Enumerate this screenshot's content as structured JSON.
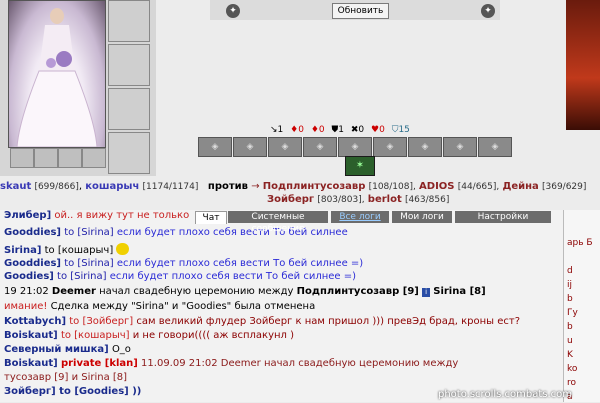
{
  "top": {
    "refresh_label": "Обновить"
  },
  "battle": {
    "stats": [
      "↘1",
      "♦0",
      "♦0",
      "⛊1",
      "✖0",
      "♥0",
      "⛉15"
    ],
    "player1": "skaut",
    "player1_hp": "[699/866]",
    "player2": "кошарыч",
    "player2_hp": "[1174/1174]",
    "versus": "против",
    "enemy1": "Подплинтусозавр",
    "enemy1_hp": "[108/108],",
    "enemy2": "ADIOS",
    "enemy2_hp": "[44/665],",
    "enemy3": "Дейна",
    "enemy3_hp": "[369/629]",
    "enemy4": "Зойберг",
    "enemy4_hp": "[803/803],",
    "enemy5": "berlot",
    "enemy5_hp": "[463/856]"
  },
  "tabs": [
    "Чат",
    "Системные сообщения",
    "Все логи",
    "Мои логи",
    "Настройки"
  ],
  "chat": [
    {
      "nick": "Элибер]",
      "text": "ой.. я вижу тут не только"
    },
    {
      "nick": "Gooddies]",
      "to": "to [Sirina]",
      "text": "если будет плохо себя вести То бей силнее"
    },
    {
      "nick": "Sirina]",
      "to": "to [кошарыч]",
      "text": ""
    },
    {
      "nick": "Gooddies]",
      "to": "to [Sirina]",
      "text": "если будет плохо себя вести То бей силнее =)"
    },
    {
      "nick": "Goodies]",
      "to": "to [Sirina]",
      "text": "если будет плохо себя вести То бей силнее =)"
    },
    {
      "time": "19 21:02",
      "nick": "Deemer",
      "text": "начал свадебную церемонию между",
      "target": "Подплинтусозавр [9]",
      "target2": "Sirina [8]"
    },
    {
      "sys": "имание!",
      "text": "Сделка между \"Sirina\" и \"Goodies\" была отменена"
    },
    {
      "nick": "Kottabych]",
      "to": "to [Зойберг]",
      "text": "сам великий флудер Зойберг к нам пришол ))) превЭд брад, кроны ест?"
    },
    {
      "nick": "Boiskaut]",
      "to": "to [кошарыч]",
      "text": "и не говори(((( аж всплакунл )"
    },
    {
      "nick": "Северный мишка]",
      "text": "O_o"
    },
    {
      "nick": "Boiskaut]",
      "private": "private [klan]",
      "date": "11.09.09 21:02",
      "text": "Deemer начал свадебную церемонию между"
    },
    {
      "text": "тусозавр [9] и Sirina [8]"
    },
    {
      "text": "Зойберг] to [Goodies] ))"
    }
  ],
  "users": [
    "арь Б",
    "d",
    "ij",
    "b",
    "Гу",
    "b",
    "u",
    "K",
    "ko",
    "ro",
    "a"
  ],
  "watermark": "photo.scrolls.combats.com"
}
